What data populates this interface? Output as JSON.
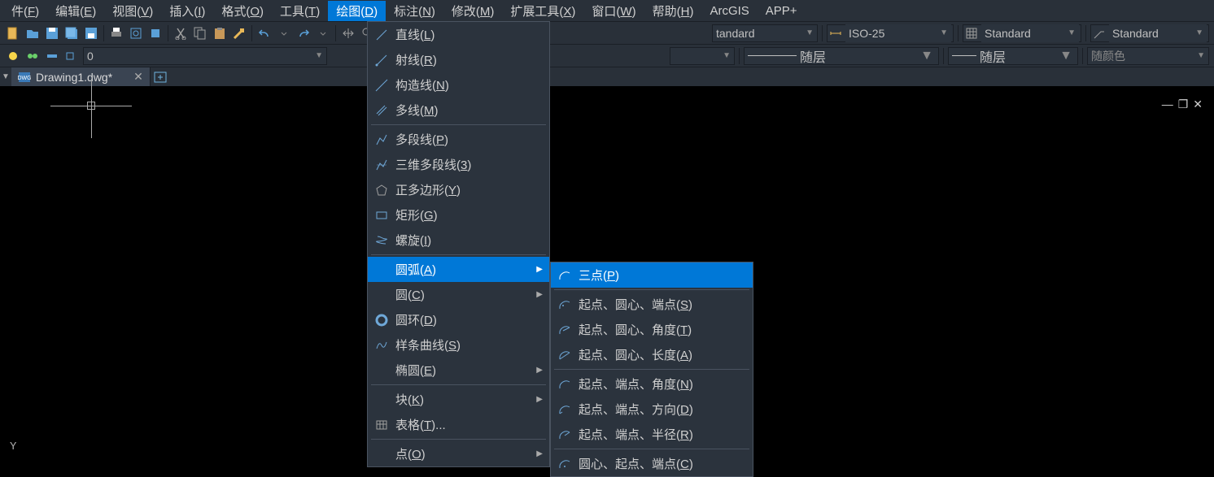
{
  "menubar": {
    "items": [
      {
        "label": "件(F)"
      },
      {
        "label": "编辑(E)"
      },
      {
        "label": "视图(V)"
      },
      {
        "label": "插入(I)"
      },
      {
        "label": "格式(O)"
      },
      {
        "label": "工具(T)"
      },
      {
        "label": "绘图(D)",
        "active": true
      },
      {
        "label": "标注(N)"
      },
      {
        "label": "修改(M)"
      },
      {
        "label": "扩展工具(X)"
      },
      {
        "label": "窗口(W)"
      },
      {
        "label": "帮助(H)"
      },
      {
        "label": "ArcGIS"
      },
      {
        "label": "APP+"
      }
    ]
  },
  "toolbar1": {
    "combo1": "tandard",
    "combo2": "ISO-25",
    "combo3": "Standard",
    "combo4": "Standard"
  },
  "toolbar2": {
    "layer": "0",
    "linetype": "随层",
    "lineweight": "随层",
    "color": "随颜色"
  },
  "tab": {
    "filename": "Drawing1.dwg*"
  },
  "draw_menu": {
    "items": [
      {
        "icon": "line-icon",
        "label": "直线(L)"
      },
      {
        "icon": "ray-icon",
        "label": "射线(R)"
      },
      {
        "icon": "xline-icon",
        "label": "构造线(N)"
      },
      {
        "icon": "mline-icon",
        "label": "多线(M)"
      },
      {
        "sep": true
      },
      {
        "icon": "pline-icon",
        "label": "多段线(P)"
      },
      {
        "icon": "3dpoly-icon",
        "label": "三维多段线(3)"
      },
      {
        "icon": "polygon-icon",
        "label": "正多边形(Y)"
      },
      {
        "icon": "rectangle-icon",
        "label": "矩形(G)"
      },
      {
        "icon": "helix-icon",
        "label": "螺旋(I)"
      },
      {
        "sep": true
      },
      {
        "icon": "arc-icon",
        "label": "圆弧(A)",
        "sub": true,
        "highlight": true
      },
      {
        "icon": "circle-icon",
        "label": "圆(C)",
        "sub": true
      },
      {
        "icon": "donut-icon",
        "label": "圆环(D)"
      },
      {
        "icon": "spline-icon",
        "label": "样条曲线(S)"
      },
      {
        "icon": "ellipse-icon",
        "label": "椭圆(E)",
        "sub": true
      },
      {
        "sep": true
      },
      {
        "icon": "block-icon",
        "label": "块(K)",
        "sub": true
      },
      {
        "icon": "table-icon",
        "label": "表格(T)..."
      },
      {
        "sep": true
      },
      {
        "icon": "point-icon",
        "label": "点(O)",
        "sub": true
      }
    ]
  },
  "arc_submenu": {
    "items": [
      {
        "icon": "arc-3p-icon",
        "label": "三点(P)",
        "highlight": true
      },
      {
        "sep": true
      },
      {
        "icon": "arc-sce-icon",
        "label": "起点、圆心、端点(S)"
      },
      {
        "icon": "arc-sca-icon",
        "label": "起点、圆心、角度(T)"
      },
      {
        "icon": "arc-scl-icon",
        "label": "起点、圆心、长度(A)"
      },
      {
        "sep": true
      },
      {
        "icon": "arc-sea-icon",
        "label": "起点、端点、角度(N)"
      },
      {
        "icon": "arc-sed-icon",
        "label": "起点、端点、方向(D)"
      },
      {
        "icon": "arc-ser-icon",
        "label": "起点、端点、半径(R)"
      },
      {
        "sep": true
      },
      {
        "icon": "arc-cse-icon",
        "label": "圆心、起点、端点(C)"
      }
    ]
  }
}
